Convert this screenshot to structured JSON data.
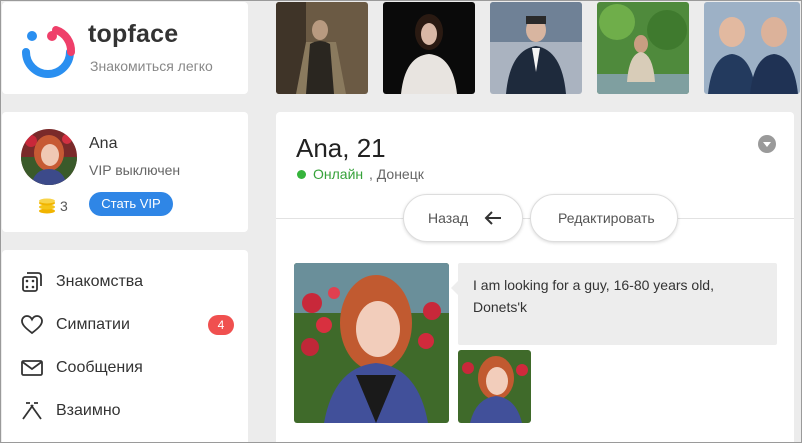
{
  "brand": {
    "name": "topface",
    "tagline": "Знакомиться легко"
  },
  "me": {
    "name": "Ana",
    "vip_status": "VIP выключен",
    "coins": "3",
    "vip_button": "Стать VIP"
  },
  "nav": [
    {
      "label": "Знакомства",
      "icon": "dice-icon"
    },
    {
      "label": "Симпатии",
      "icon": "heart-icon",
      "badge": "4"
    },
    {
      "label": "Сообщения",
      "icon": "envelope-icon"
    },
    {
      "label": "Взаимно",
      "icon": "mutual-icon"
    }
  ],
  "profile": {
    "title": "Ana, 21",
    "online": "Онлайн",
    "city": ", Донецк",
    "back_label": "Назад",
    "edit_label": "Редактировать",
    "about": "I am looking for a guy, 16-80 years old, Donets'k"
  },
  "colors": {
    "accent": "#2f86e6",
    "online": "#36b43c",
    "badge": "#f0504f"
  }
}
